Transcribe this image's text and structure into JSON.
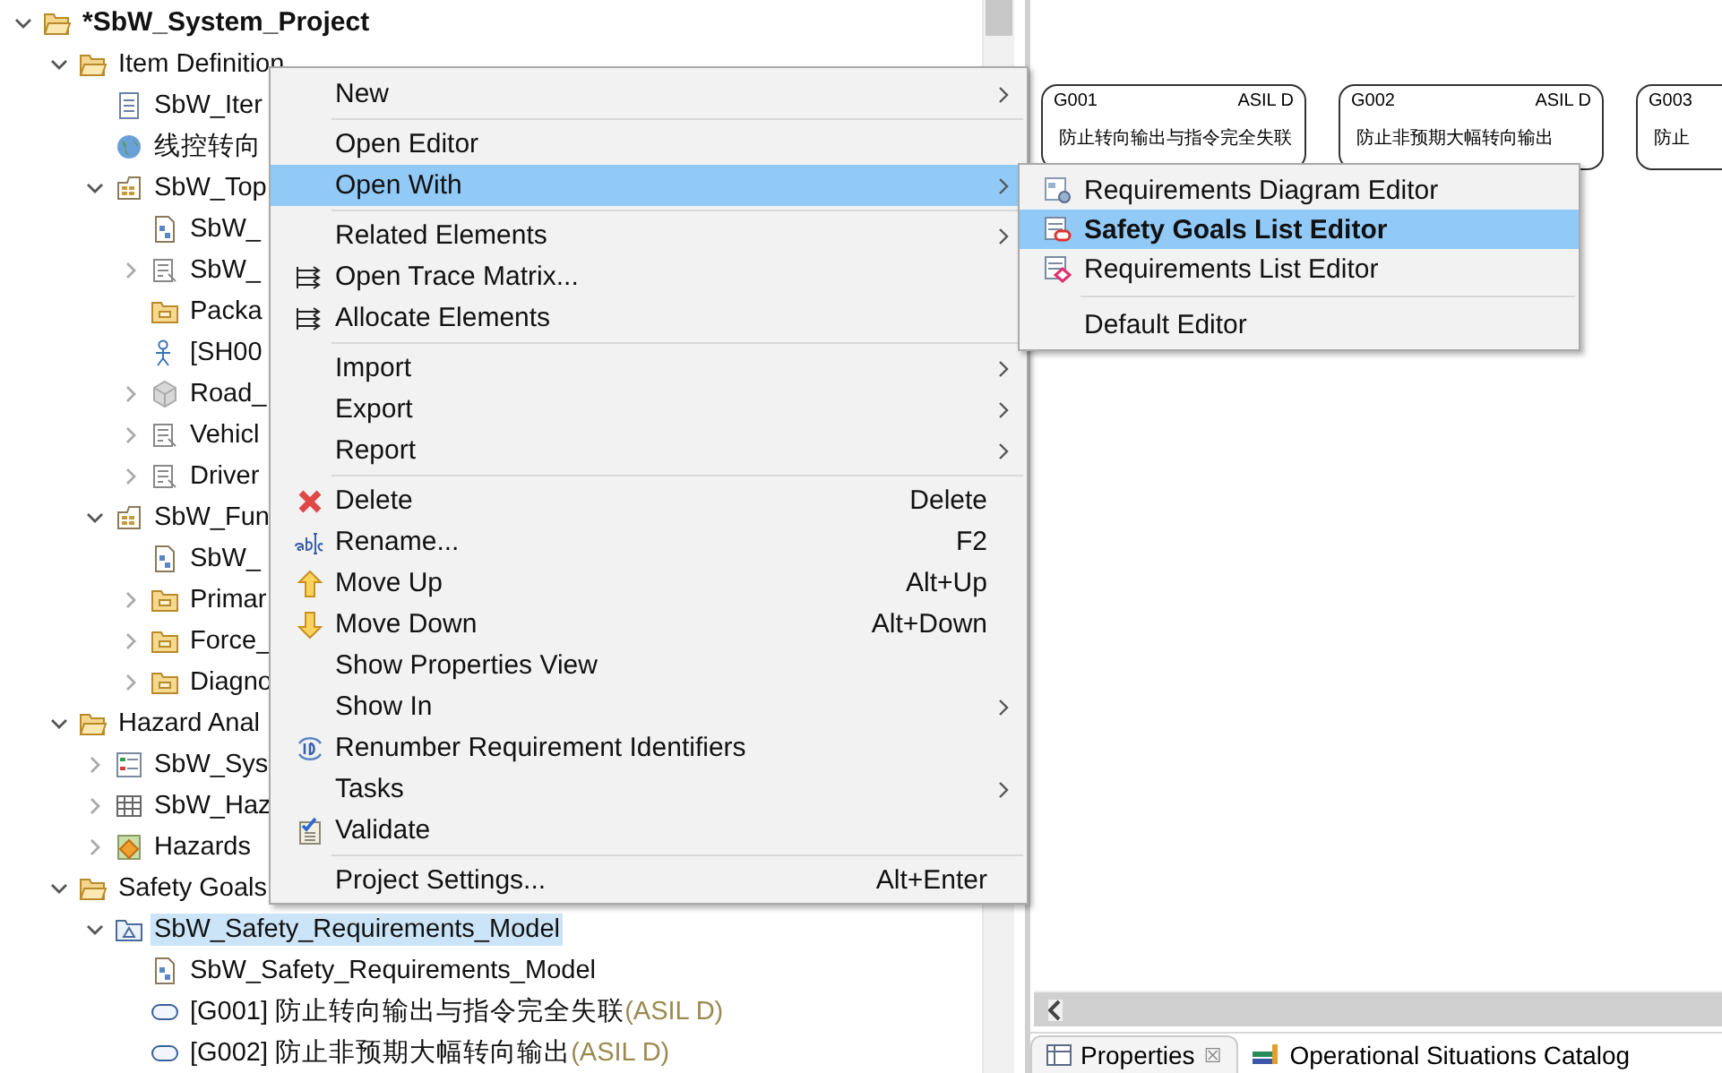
{
  "tree": [
    {
      "label": "*SbW_System_Project",
      "kind": "project",
      "expanded": true,
      "children": [
        {
          "label": "Item Definition",
          "kind": "folder",
          "expanded": true,
          "children": [
            {
              "label": "SbW_Iter",
              "kind": "doc"
            },
            {
              "label": "线控转向",
              "kind": "globe"
            },
            {
              "label": "SbW_Top",
              "kind": "package",
              "expanded": true,
              "children": [
                {
                  "label": "SbW_",
                  "kind": "diagram"
                },
                {
                  "label": "SbW_",
                  "kind": "spec",
                  "expanded": false
                },
                {
                  "label": "Packa",
                  "kind": "folder-closed"
                },
                {
                  "label": "[SH00",
                  "kind": "actor"
                },
                {
                  "label": "Road_",
                  "kind": "model",
                  "expanded": false
                },
                {
                  "label": "Vehicl",
                  "kind": "spec",
                  "expanded": false
                },
                {
                  "label": "Driver",
                  "kind": "spec",
                  "expanded": false
                }
              ]
            },
            {
              "label": "SbW_Fun",
              "kind": "package",
              "expanded": true,
              "children": [
                {
                  "label": "SbW_",
                  "kind": "diagram"
                },
                {
                  "label": "Primar",
                  "kind": "folder-closed",
                  "expanded": false
                },
                {
                  "label": "Force_",
                  "kind": "folder-closed",
                  "expanded": false
                },
                {
                  "label": "Diagno",
                  "kind": "folder-closed",
                  "expanded": false
                }
              ]
            }
          ]
        },
        {
          "label": "Hazard Anal",
          "kind": "folder",
          "expanded": true,
          "children": [
            {
              "label": "SbW_Sys",
              "kind": "list",
              "expanded": false
            },
            {
              "label": "SbW_Haz",
              "kind": "table",
              "expanded": false
            },
            {
              "label": "Hazards",
              "kind": "hazard",
              "expanded": false
            }
          ]
        },
        {
          "label": "Safety Goals",
          "kind": "folder",
          "expanded": true,
          "children": [
            {
              "label": "SbW_Safety_Requirements_Model",
              "kind": "reqmodel",
              "selected": true,
              "expanded": true,
              "children": [
                {
                  "label": "SbW_Safety_Requirements_Model",
                  "kind": "diagram"
                },
                {
                  "label": "[G001] 防止转向输出与指令完全失联",
                  "suffix": "(ASIL D)",
                  "kind": "goal"
                },
                {
                  "label": "[G002] 防止非预期大幅转向输出",
                  "suffix": "(ASIL D)",
                  "kind": "goal"
                }
              ]
            }
          ]
        }
      ]
    }
  ],
  "goal_cards": [
    {
      "id": "G001",
      "asil": "ASIL D",
      "text": "防止转向输出与指令完全失联"
    },
    {
      "id": "G002",
      "asil": "ASIL D",
      "text": "防止非预期大幅转向输出"
    },
    {
      "id": "G003",
      "text": "防止"
    }
  ],
  "bottom_tabs": [
    {
      "label": "Properties",
      "close": "☒",
      "kind": "properties",
      "selected": true
    },
    {
      "label": "Operational Situations Catalog",
      "kind": "catalog",
      "selected": false
    }
  ],
  "menu": {
    "items": [
      {
        "kind": "plain",
        "label": "New",
        "submenu": true,
        "selected": false
      },
      {
        "kind": "separator"
      },
      {
        "kind": "plain",
        "label": "Open Editor",
        "selected": false
      },
      {
        "kind": "plain",
        "label": "Open With",
        "submenu": true,
        "selected": true
      },
      {
        "kind": "separator"
      },
      {
        "kind": "plain",
        "label": "Related Elements",
        "submenu": true,
        "selected": false
      },
      {
        "kind": "trace",
        "label": "Open Trace Matrix...",
        "selected": false
      },
      {
        "kind": "trace",
        "label": "Allocate Elements",
        "selected": false
      },
      {
        "kind": "separator"
      },
      {
        "kind": "plain",
        "label": "Import",
        "submenu": true,
        "selected": false
      },
      {
        "kind": "plain",
        "label": "Export",
        "submenu": true,
        "selected": false
      },
      {
        "kind": "plain",
        "label": "Report",
        "submenu": true,
        "selected": false
      },
      {
        "kind": "separator"
      },
      {
        "kind": "delete",
        "label": "Delete",
        "shortcut": "Delete",
        "selected": false
      },
      {
        "kind": "rename",
        "label": "Rename...",
        "shortcut": "F2",
        "selected": false
      },
      {
        "kind": "up",
        "label": "Move Up",
        "shortcut": "Alt+Up",
        "selected": false
      },
      {
        "kind": "down",
        "label": "Move Down",
        "shortcut": "Alt+Down",
        "selected": false
      },
      {
        "kind": "plain",
        "label": "Show Properties View",
        "selected": false
      },
      {
        "kind": "plain",
        "label": "Show In",
        "submenu": true,
        "selected": false
      },
      {
        "kind": "renumber",
        "label": "Renumber Requirement Identifiers",
        "selected": false
      },
      {
        "kind": "plain",
        "label": "Tasks",
        "submenu": true,
        "selected": false
      },
      {
        "kind": "validate",
        "label": "Validate",
        "selected": false
      },
      {
        "kind": "separator"
      },
      {
        "kind": "plain",
        "label": "Project Settings...",
        "shortcut": "Alt+Enter",
        "selected": false
      }
    ]
  },
  "submenu": {
    "items": [
      {
        "kind": "diagram-editor",
        "label": "Requirements Diagram Editor",
        "selected": false,
        "default": false
      },
      {
        "kind": "goal-list",
        "label": "Safety Goals List Editor",
        "selected": true,
        "default": true
      },
      {
        "kind": "req-list",
        "label": "Requirements List Editor",
        "selected": false,
        "default": false
      },
      {
        "kind": "separator"
      },
      {
        "kind": "plain",
        "label": "Default Editor",
        "selected": false,
        "default": false
      }
    ]
  }
}
